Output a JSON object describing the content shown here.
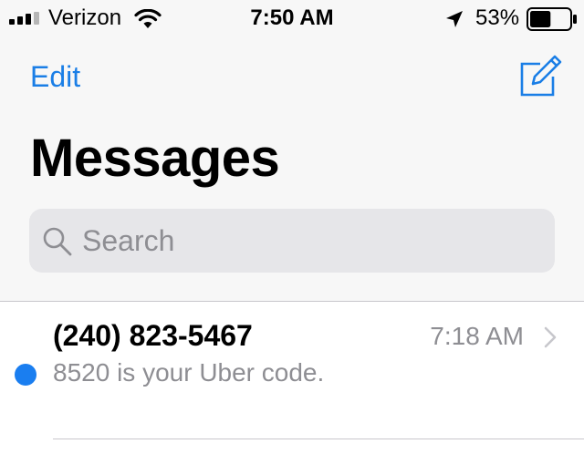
{
  "status_bar": {
    "carrier": "Verizon",
    "time": "7:50 AM",
    "battery_percent": "53%",
    "battery_level": 0.53,
    "signal_bars_filled": 3,
    "signal_bars_total": 4,
    "icons": [
      "signal-icon",
      "wifi-icon",
      "location-arrow-icon",
      "battery-icon"
    ]
  },
  "nav": {
    "edit_label": "Edit",
    "compose_icon": "compose-icon"
  },
  "page": {
    "title": "Messages"
  },
  "search": {
    "placeholder": "Search",
    "value": "",
    "icon": "search-icon"
  },
  "conversations": [
    {
      "name": "(240) 823-5467",
      "time": "7:18 AM",
      "preview": "8520 is your Uber code.",
      "unread": true
    }
  ],
  "colors": {
    "accent": "#1a7ee6",
    "unread_dot": "#1a7ef0",
    "secondary_text": "#8e8e93",
    "background": "#f7f7f7",
    "search_fill": "#e6e6e9"
  }
}
